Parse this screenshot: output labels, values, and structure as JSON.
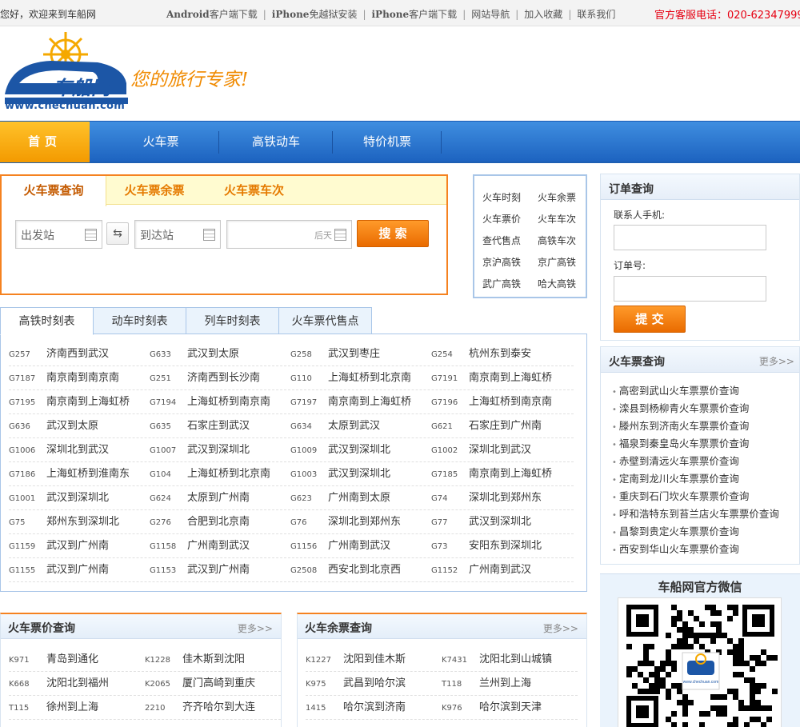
{
  "topbar": {
    "welcome": "您好，欢迎来到车船网",
    "links": [
      {
        "bold": "Android",
        "text": "客户端下载"
      },
      {
        "bold": "iPhone",
        "text": "免越狱安装"
      },
      {
        "bold": "iPhone",
        "text": "客户端下载"
      },
      {
        "bold": "",
        "text": "网站导航"
      },
      {
        "bold": "",
        "text": "加入收藏"
      },
      {
        "bold": "",
        "text": "联系我们"
      }
    ],
    "phone_label": "官方客服电话：",
    "phone_number": "020-62347999"
  },
  "header": {
    "logo_text": "车船网",
    "slogan": "您的旅行专家!",
    "url": "www.chechuan.com"
  },
  "nav": [
    "首页",
    "火车票",
    "高铁动车",
    "特价机票"
  ],
  "query": {
    "tabs": [
      "火车票查询",
      "火车票余票",
      "火车票车次"
    ],
    "from_placeholder": "出发站",
    "to_placeholder": "到达站",
    "date_hint": "后天",
    "search_button": "搜 索",
    "swap_icon": "⇆"
  },
  "quick_links": [
    "火车时刻",
    "火车余票",
    "火车票价",
    "火车车次",
    "查代售点",
    "高铁车次",
    "京沪高铁",
    "京广高铁",
    "武广高铁",
    "哈大高铁"
  ],
  "schedule": {
    "tabs": [
      "高铁时刻表",
      "动车时刻表",
      "列车时刻表",
      "火车票代售点"
    ],
    "rows": [
      [
        [
          "G257",
          "济南西到武汉"
        ],
        [
          "G633",
          "武汉到太原"
        ],
        [
          "G258",
          "武汉到枣庄"
        ],
        [
          "G254",
          "杭州东到泰安"
        ]
      ],
      [
        [
          "G7187",
          "南京南到南京南"
        ],
        [
          "G251",
          "济南西到长沙南"
        ],
        [
          "G110",
          "上海虹桥到北京南"
        ],
        [
          "G7191",
          "南京南到上海虹桥"
        ]
      ],
      [
        [
          "G7195",
          "南京南到上海虹桥"
        ],
        [
          "G7194",
          "上海虹桥到南京南"
        ],
        [
          "G7197",
          "南京南到上海虹桥"
        ],
        [
          "G7196",
          "上海虹桥到南京南"
        ]
      ],
      [
        [
          "G636",
          "武汉到太原"
        ],
        [
          "G635",
          "石家庄到武汉"
        ],
        [
          "G634",
          "太原到武汉"
        ],
        [
          "G621",
          "石家庄到广州南"
        ]
      ],
      [
        [
          "G1006",
          "深圳北到武汉"
        ],
        [
          "G1007",
          "武汉到深圳北"
        ],
        [
          "G1009",
          "武汉到深圳北"
        ],
        [
          "G1002",
          "深圳北到武汉"
        ]
      ],
      [
        [
          "G7186",
          "上海虹桥到淮南东"
        ],
        [
          "G104",
          "上海虹桥到北京南"
        ],
        [
          "G1003",
          "武汉到深圳北"
        ],
        [
          "G7185",
          "南京南到上海虹桥"
        ]
      ],
      [
        [
          "G1001",
          "武汉到深圳北"
        ],
        [
          "G624",
          "太原到广州南"
        ],
        [
          "G623",
          "广州南到太原"
        ],
        [
          "G74",
          "深圳北到郑州东"
        ]
      ],
      [
        [
          "G75",
          "郑州东到深圳北"
        ],
        [
          "G276",
          "合肥到北京南"
        ],
        [
          "G76",
          "深圳北到郑州东"
        ],
        [
          "G77",
          "武汉到深圳北"
        ]
      ],
      [
        [
          "G1159",
          "武汉到广州南"
        ],
        [
          "G1158",
          "广州南到武汉"
        ],
        [
          "G1156",
          "广州南到武汉"
        ],
        [
          "G73",
          "安阳东到深圳北"
        ]
      ],
      [
        [
          "G1155",
          "武汉到广州南"
        ],
        [
          "G1153",
          "武汉到广州南"
        ],
        [
          "G2508",
          "西安北到北京西"
        ],
        [
          "G1152",
          "广州南到武汉"
        ]
      ]
    ]
  },
  "price_panel": {
    "title": "火车票价查询",
    "more": "更多>>",
    "rows": [
      [
        [
          "K971",
          "青岛到通化"
        ],
        [
          "K1228",
          "佳木斯到沈阳"
        ]
      ],
      [
        [
          "K668",
          "沈阳北到福州"
        ],
        [
          "K2065",
          "厦门高崎到重庆"
        ]
      ],
      [
        [
          "T115",
          "徐州到上海"
        ],
        [
          "2210",
          "齐齐哈尔到大连"
        ]
      ]
    ]
  },
  "remain_panel": {
    "title": "火车余票查询",
    "more": "更多>>",
    "rows": [
      [
        [
          "K1227",
          "沈阳到佳木斯"
        ],
        [
          "K7431",
          "沈阳北到山城镇"
        ]
      ],
      [
        [
          "K975",
          "武昌到哈尔滨"
        ],
        [
          "T118",
          "兰州到上海"
        ]
      ],
      [
        [
          "1415",
          "哈尔滨到济南"
        ],
        [
          "K976",
          "哈尔滨到天津"
        ]
      ]
    ]
  },
  "order": {
    "title": "订单查询",
    "phone_label": "联系人手机:",
    "order_label": "订单号:",
    "submit": "提 交"
  },
  "ticket_query": {
    "title": "火车票查询",
    "more": "更多>>",
    "items": [
      "高密到武山火车票票价查询",
      "滦县到杨柳青火车票票价查询",
      "滕州东到济南火车票票价查询",
      "福泉到秦皇岛火车票票价查询",
      "赤壁到清远火车票票价查询",
      "定南到龙川火车票票价查询",
      "重庆到石门坎火车票票价查询",
      "呼和浩特东到苔兰店火车票票价查询",
      "昌黎到贵定火车票票价查询",
      "西安到华山火车票票价查询"
    ]
  },
  "weixin": {
    "title": "车船网官方微信",
    "qr_label": "www.chechuan.com"
  },
  "colors": {
    "nav_blue": "#1d63c0",
    "orange": "#f58220",
    "phone_red": "#e60012"
  }
}
